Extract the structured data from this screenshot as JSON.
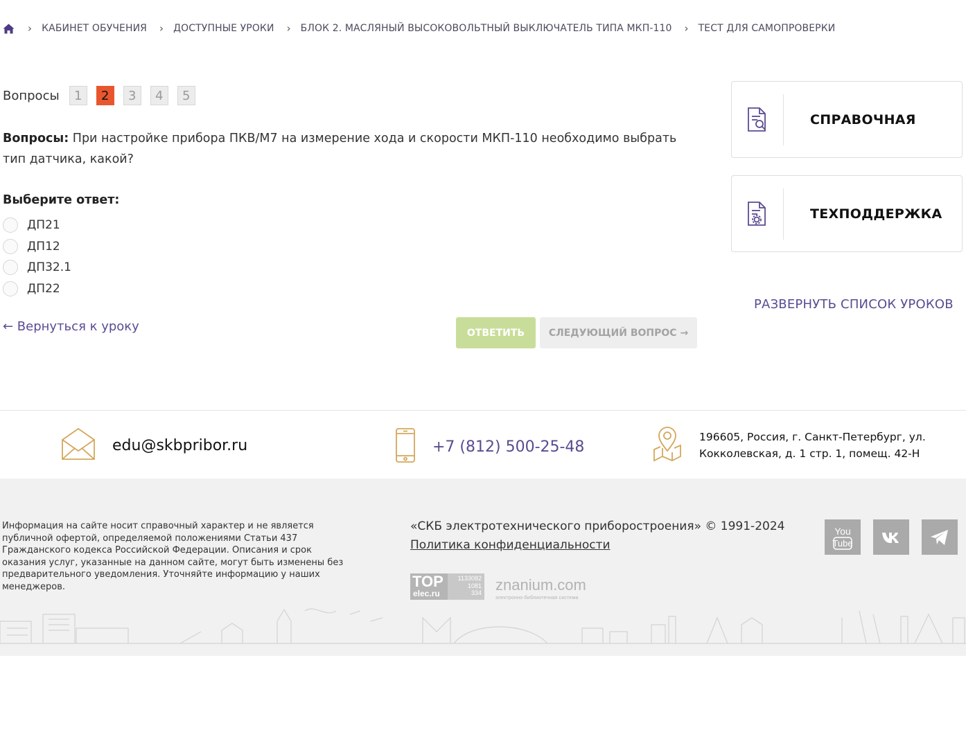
{
  "breadcrumb": {
    "items": [
      "КАБИНЕТ ОБУЧЕНИЯ",
      "ДОСТУПНЫЕ УРОКИ",
      "БЛОК 2. МАСЛЯНЫЙ ВЫСОКОВОЛЬТНЫЙ ВЫКЛЮЧАТЕЛЬ ТИПА МКП-110",
      "ТЕСТ ДЛЯ САМОПРОВЕРКИ"
    ]
  },
  "questions_nav": {
    "label": "Вопросы",
    "numbers": [
      "1",
      "2",
      "3",
      "4",
      "5"
    ],
    "active": "2"
  },
  "question": {
    "label": "Вопросы:",
    "text": "При настройке прибора ПКВ/М7 на измерение хода и скорости МКП-110 необходимо выбрать тип датчика, какой?"
  },
  "answer_prompt": "Выберите ответ:",
  "answers": [
    "ДП21",
    "ДП12",
    "ДП32.1",
    "ДП22"
  ],
  "back_link": "← Вернуться к уроку",
  "buttons": {
    "answer": "ОТВЕТИТЬ",
    "next": "СЛЕДУЮЩИЙ ВОПРОС →"
  },
  "sidebar": {
    "reference": "СПРАВОЧНАЯ",
    "support": "ТЕХПОДДЕРЖКА",
    "expand": "РАЗВЕРНУТЬ СПИСОК УРОКОВ"
  },
  "contacts": {
    "email": "edu@skbpribor.ru",
    "phone": "+7 (812) 500-25-48",
    "address_line1": "196605, Россия, г. Санкт-Петербург, ул.",
    "address_line2": "Кокколевская, д. 1 стр. 1, помещ. 42-Н"
  },
  "footer": {
    "disclaimer": "Информация на сайте носит справочный характер и не является публичной офертой, определяемой положениями Статьи 437 Гражданского кодекса Российской Федерации. Описания и срок оказания услуг, указанные на данном сайте, могут быть изменены без предварительного уведомления. Уточняйте информацию у наших менеджеров.",
    "copyright": "«СКБ электротехнического приборостроения» © 1991-2024",
    "policy": "Политика конфиденциальности",
    "top_logo": {
      "top": "TOP",
      "bottom": "elec.ru",
      "n1": "1133082",
      "n2": "1081",
      "n3": "334"
    },
    "znanium": {
      "name": "znanium.com",
      "sub": "электронно-библиотечная система"
    }
  },
  "colors": {
    "accent": "#5a4b92",
    "active_page": "#e8562e",
    "answer_button": "#c9dd9a",
    "footer_bg": "#f1f1f1",
    "icon_gold": "#d4a75b"
  }
}
